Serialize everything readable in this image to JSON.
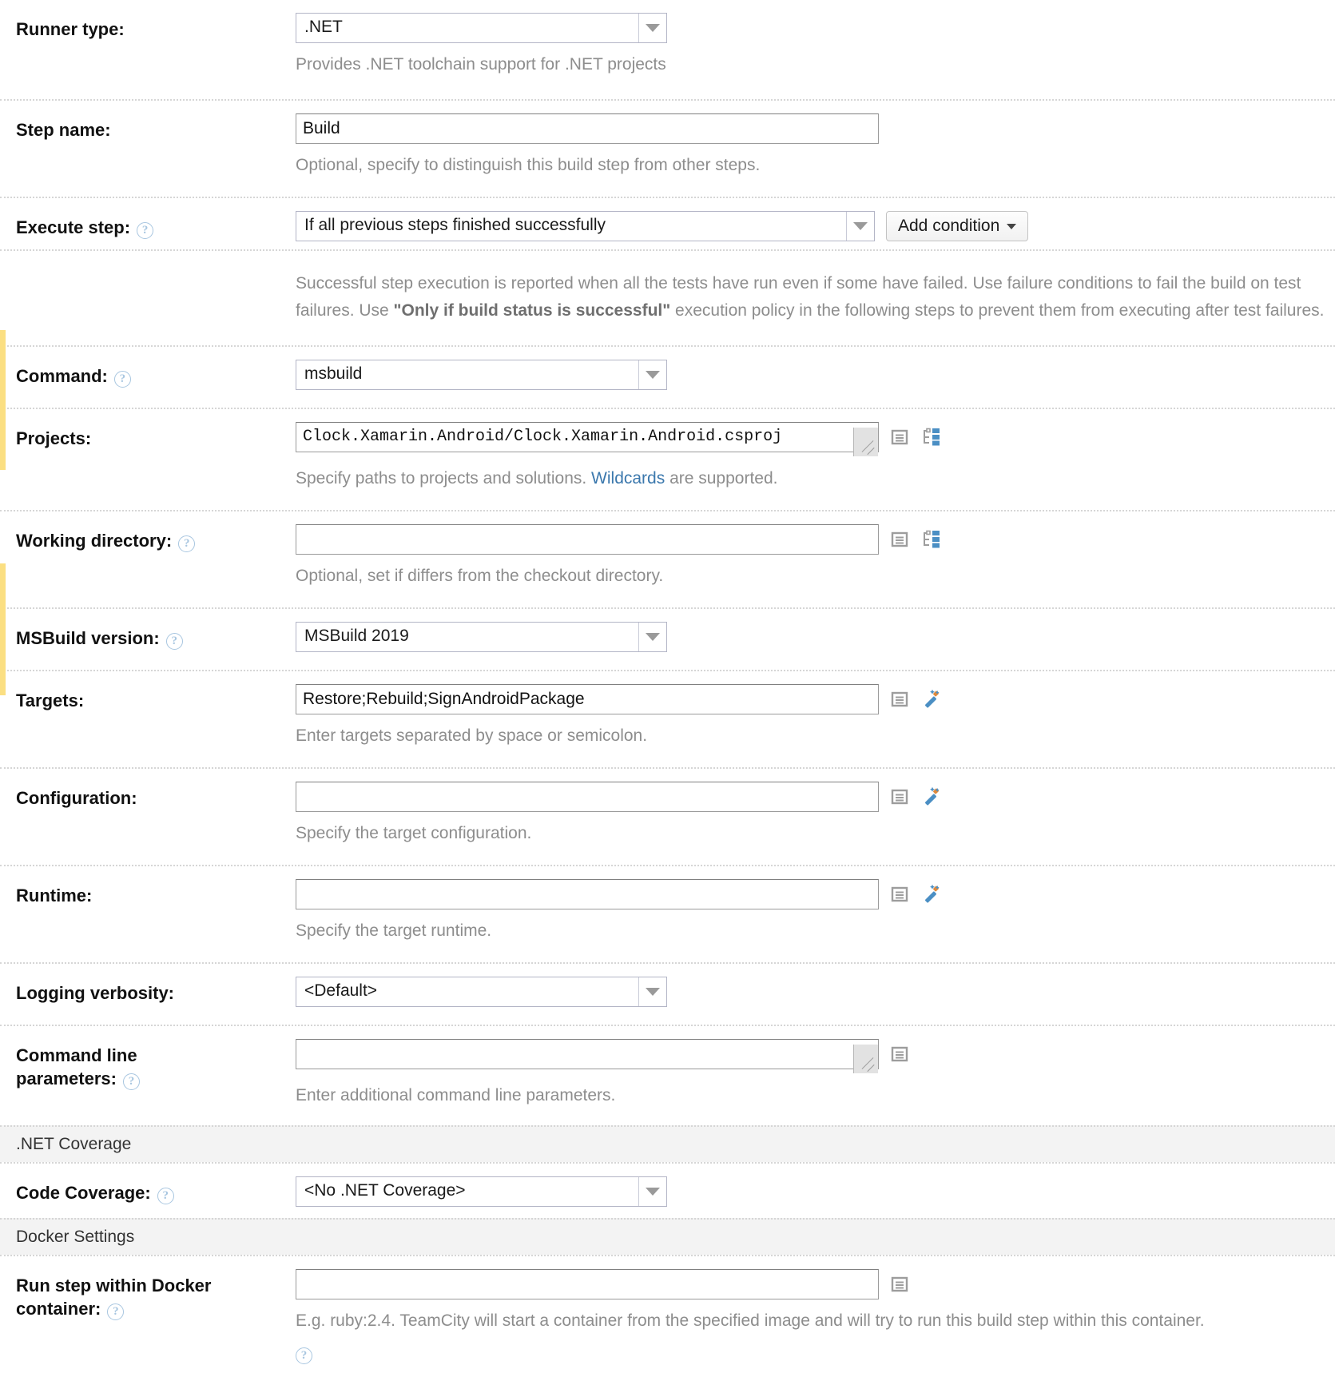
{
  "form": {
    "rows": {
      "runner_type": {
        "label": "Runner type:",
        "value": ".NET",
        "hint": "Provides .NET toolchain support for .NET projects"
      },
      "step_name": {
        "label": "Step name:",
        "value": "Build",
        "hint": "Optional, specify to distinguish this build step from other steps."
      },
      "execute_step": {
        "label": "Execute step:",
        "value": "If all previous steps finished successfully",
        "button": "Add condition",
        "hint_part1": "Successful step execution is reported when all the tests have run even if some have failed. Use failure conditions to fail the build on test failures. Use ",
        "hint_bold": "\"Only if build status is successful\"",
        "hint_part2": " execution policy in the following steps to prevent them from executing after test failures."
      },
      "command": {
        "label": "Command:",
        "value": "msbuild"
      },
      "projects": {
        "label": "Projects:",
        "value": "Clock.Xamarin.Android/Clock.Xamarin.Android.csproj",
        "hint_part1": "Specify paths to projects and solutions. ",
        "hint_link": "Wildcards",
        "hint_part2": " are supported."
      },
      "working_directory": {
        "label": "Working directory:",
        "value": "",
        "hint": "Optional, set if differs from the checkout directory."
      },
      "msbuild_version": {
        "label": "MSBuild version:",
        "value": "MSBuild 2019"
      },
      "targets": {
        "label": "Targets:",
        "value": "Restore;Rebuild;SignAndroidPackage",
        "hint": "Enter targets separated by space or semicolon."
      },
      "configuration": {
        "label": "Configuration:",
        "value": "",
        "hint": "Specify the target configuration."
      },
      "runtime": {
        "label": "Runtime:",
        "value": "",
        "hint": "Specify the target runtime."
      },
      "logging_verbosity": {
        "label": "Logging verbosity:",
        "value": "<Default>"
      },
      "command_line_parameters": {
        "label_line1": "Command line",
        "label_line2": "parameters:",
        "value": "",
        "hint": "Enter additional command line parameters."
      },
      "code_coverage": {
        "label": "Code Coverage:",
        "value": "<No .NET Coverage>"
      },
      "docker_container": {
        "label_line1": "Run step within Docker",
        "label_line2": "container:",
        "value": "",
        "hint": "E.g. ruby:2.4. TeamCity will start a container from the specified image and will try to run this build step within this container."
      }
    },
    "sections": {
      "net_coverage": ".NET Coverage",
      "docker_settings": "Docker Settings"
    },
    "icons": {
      "help": "?",
      "parameter_list": "parameter-list-icon",
      "vcs_tree": "vcs-tree-icon",
      "magic_wand": "magic-wand-icon"
    },
    "colors": {
      "accent_bar": "#fbdf82",
      "link": "#3b78ad",
      "hint_text": "#8d8d8d",
      "section_bg": "#f3f3f3",
      "icon_blue": "#4b8fc4"
    }
  }
}
